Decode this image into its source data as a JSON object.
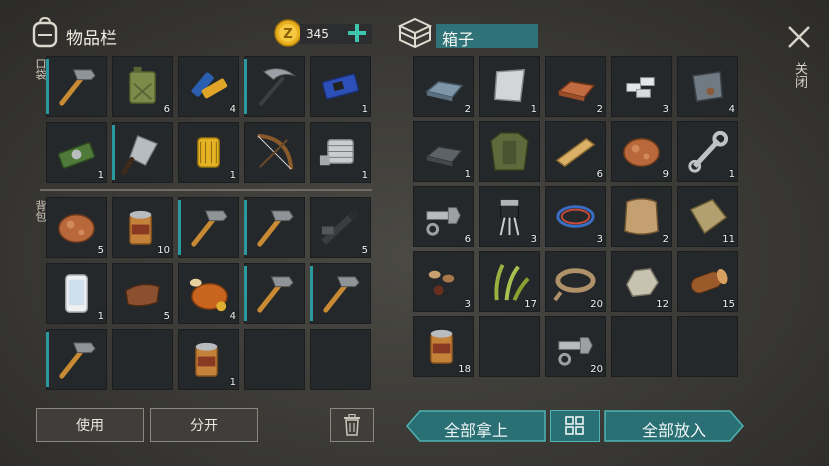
{
  "inventory": {
    "title": "物品栏",
    "coins": "345",
    "pocket_label": "口袋",
    "backpack_label": "背包",
    "use_label": "使用",
    "split_label": "分开"
  },
  "box": {
    "title": "箱子",
    "close_label": "关闭",
    "take_all_label": "全部拿上",
    "put_all_label": "全部放入"
  },
  "pocket": [
    {
      "item": "hammer",
      "count": ""
    },
    {
      "item": "jerrycan",
      "count": "6"
    },
    {
      "item": "batteries",
      "count": "4"
    },
    {
      "item": "pickaxe",
      "count": ""
    },
    {
      "item": "circuit-board",
      "count": "1"
    },
    {
      "item": "chip",
      "count": "1"
    },
    {
      "item": "cleaver",
      "count": ""
    },
    {
      "item": "oil-filter",
      "count": "1"
    },
    {
      "item": "bow",
      "count": ""
    },
    {
      "item": "engine-part",
      "count": "1"
    }
  ],
  "backpack": [
    {
      "item": "meat",
      "count": "5"
    },
    {
      "item": "canned-food",
      "count": "10"
    },
    {
      "item": "hammer",
      "count": ""
    },
    {
      "item": "hammer",
      "count": ""
    },
    {
      "item": "pipes",
      "count": "5"
    },
    {
      "item": "phone",
      "count": "1"
    },
    {
      "item": "leather",
      "count": "5"
    },
    {
      "item": "roast-chicken",
      "count": "4"
    },
    {
      "item": "hammer",
      "count": ""
    },
    {
      "item": "hammer",
      "count": ""
    },
    {
      "item": "hammer",
      "count": ""
    },
    {
      "item": "empty",
      "count": ""
    },
    {
      "item": "canned-food",
      "count": "1"
    },
    {
      "item": "empty",
      "count": ""
    },
    {
      "item": "empty",
      "count": ""
    }
  ],
  "chest": [
    {
      "item": "metal-bar",
      "count": "2"
    },
    {
      "item": "steel-plate",
      "count": "1"
    },
    {
      "item": "copper-bar",
      "count": "2"
    },
    {
      "item": "aluminum-bars",
      "count": "3"
    },
    {
      "item": "scrap-metal",
      "count": "4"
    },
    {
      "item": "iron-bar",
      "count": "1"
    },
    {
      "item": "armored-jacket",
      "count": ""
    },
    {
      "item": "wood-plank",
      "count": "6"
    },
    {
      "item": "meat",
      "count": "9"
    },
    {
      "item": "wrench",
      "count": "1"
    },
    {
      "item": "bolt",
      "count": "6"
    },
    {
      "item": "transistor",
      "count": "3"
    },
    {
      "item": "wire",
      "count": "3"
    },
    {
      "item": "hide",
      "count": "2"
    },
    {
      "item": "cloth",
      "count": "11"
    },
    {
      "item": "seeds",
      "count": "3"
    },
    {
      "item": "plant-fiber",
      "count": "17"
    },
    {
      "item": "rope",
      "count": "20"
    },
    {
      "item": "stone",
      "count": "12"
    },
    {
      "item": "log",
      "count": "15"
    },
    {
      "item": "canned-food",
      "count": "18"
    },
    {
      "item": "empty",
      "count": ""
    },
    {
      "item": "bolt",
      "count": "20"
    },
    {
      "item": "empty",
      "count": ""
    },
    {
      "item": "empty",
      "count": ""
    }
  ],
  "colors": {
    "accent": "#2a6f74",
    "bar": "#2b9aa0",
    "coin": "#e8b020"
  }
}
